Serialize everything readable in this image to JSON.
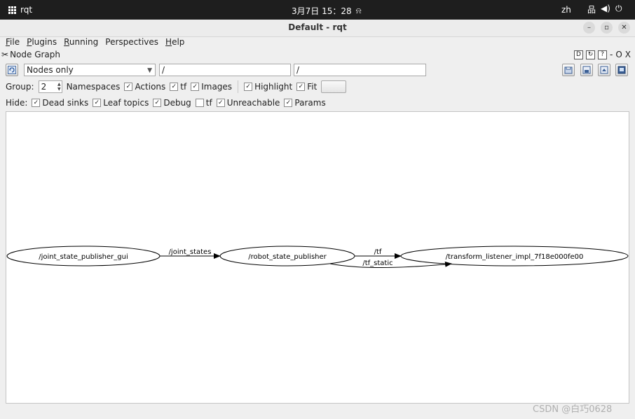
{
  "topbar": {
    "activities": "rqt",
    "clock": "3月7日 15：28",
    "lang": "zh"
  },
  "window": {
    "title": "Default - rqt"
  },
  "menu": {
    "file": "File",
    "plugins": "Plugins",
    "running": "Running",
    "perspectives": "Perspectives",
    "help": "Help"
  },
  "plugin": {
    "name": "Node Graph",
    "ctrl_d": "D",
    "ctrl_min": "-",
    "ctrl_o": "O",
    "ctrl_x": "X"
  },
  "toolbar": {
    "mode": "Nodes only",
    "filter1": "/",
    "filter2": "/"
  },
  "options": {
    "group_label": "Group:",
    "group_value": "2",
    "namespaces": "Namespaces",
    "actions": "Actions",
    "tf": "tf",
    "images": "Images",
    "highlight": "Highlight",
    "fit": "Fit"
  },
  "hide": {
    "label": "Hide:",
    "dead_sinks": "Dead sinks",
    "leaf_topics": "Leaf topics",
    "debug": "Debug",
    "tf": "tf",
    "unreachable": "Unreachable",
    "params": "Params"
  },
  "graph": {
    "nodes": [
      "/joint_state_publisher_gui",
      "/robot_state_publisher",
      "/transform_listener_impl_7f18e000fe00"
    ],
    "edges": [
      "/joint_states",
      "/tf",
      "/tf_static"
    ]
  },
  "watermark": "CSDN @白巧0628"
}
